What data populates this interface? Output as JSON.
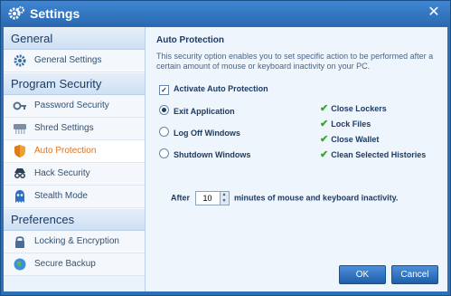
{
  "window": {
    "title": "Settings",
    "close_glyph": "✕"
  },
  "sidebar": {
    "sections": [
      {
        "header": "General",
        "items": [
          {
            "label": "General Settings",
            "icon": "gear-icon"
          }
        ]
      },
      {
        "header": "Program Security",
        "items": [
          {
            "label": "Password Security",
            "icon": "key-icon"
          },
          {
            "label": "Shred Settings",
            "icon": "shredder-icon"
          },
          {
            "label": "Auto Protection",
            "icon": "shield-icon",
            "active": true
          },
          {
            "label": "Hack Security",
            "icon": "spy-icon"
          },
          {
            "label": "Stealth Mode",
            "icon": "ghost-icon"
          }
        ]
      },
      {
        "header": "Preferences",
        "items": [
          {
            "label": "Locking & Encryption",
            "icon": "lock-icon"
          },
          {
            "label": "Secure Backup",
            "icon": "globe-icon"
          }
        ]
      }
    ]
  },
  "main": {
    "title": "Auto Protection",
    "description": "This security option enables you to set specific action to be performed after a certain amount of mouse or keyboard inactivity on your PC.",
    "activate_label": "Activate Auto Protection",
    "activate_checked": true,
    "options": [
      {
        "label": "Exit Application",
        "selected": true
      },
      {
        "label": "Log Off Windows",
        "selected": false
      },
      {
        "label": "Shutdown Windows",
        "selected": false
      }
    ],
    "features": [
      "Close Lockers",
      "Lock Files",
      "Close Wallet",
      "Clean Selected Histories"
    ],
    "after_label": "After",
    "minutes_value": "10",
    "minutes_suffix": "minutes of mouse and keyboard inactivity."
  },
  "footer": {
    "ok_label": "OK",
    "cancel_label": "Cancel"
  },
  "colors": {
    "titlebar": "#2e6fb6",
    "active_item": "#e0731a",
    "check_mark": "#3aa52a"
  }
}
